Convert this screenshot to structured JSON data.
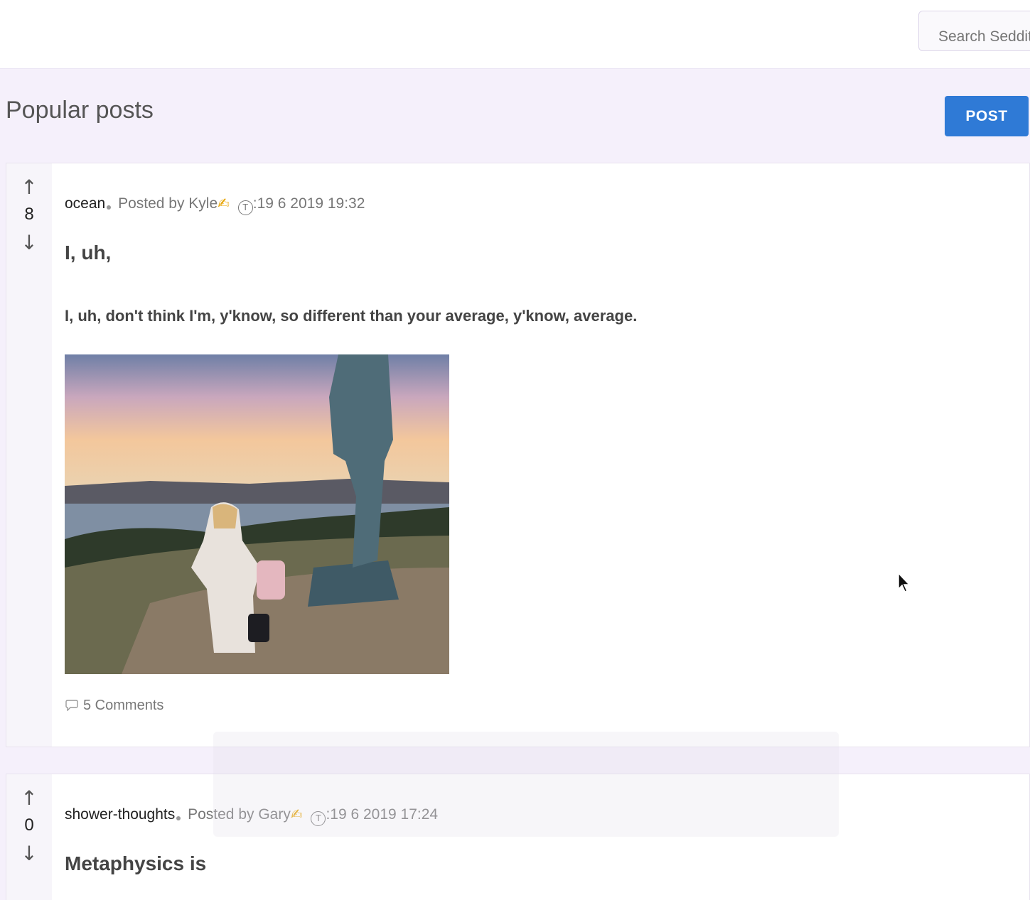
{
  "header": {
    "search_placeholder": "Search Seddit"
  },
  "page": {
    "title": "Popular posts",
    "post_button": "POST"
  },
  "posts": [
    {
      "subreddit": "ocean",
      "posted_by": "Posted by Kyle",
      "timestamp": ":19 6 2019 19:32",
      "votes": "8",
      "title": "I, uh,",
      "body": "I, uh, don't think I'm, y'know, so different than your average, y'know, average.",
      "comments": "5 Comments",
      "image_icon": "photo-statue-coast"
    },
    {
      "subreddit": "shower-thoughts",
      "posted_by": "Posted by Gary",
      "timestamp": ":19 6 2019 17:24",
      "votes": "0",
      "title": "Metaphysics is"
    }
  ],
  "icons": {
    "upvote": "↑",
    "downvote": "↓",
    "pen": "✍",
    "clock": "T"
  },
  "colors": {
    "accent": "#2f7ad6",
    "page_bg": "#f5f0fb"
  }
}
